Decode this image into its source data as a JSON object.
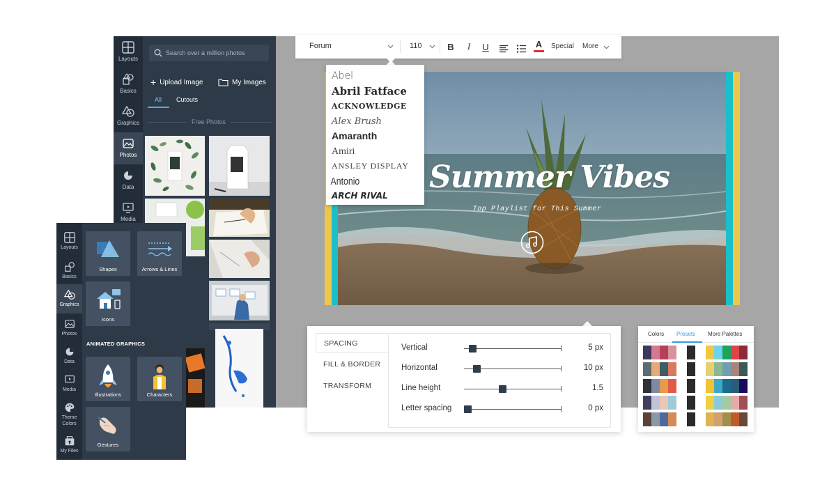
{
  "sidebar": {
    "items": [
      {
        "label": "Layouts"
      },
      {
        "label": "Basics"
      },
      {
        "label": "Graphics"
      },
      {
        "label": "Photos"
      },
      {
        "label": "Data"
      },
      {
        "label": "Media"
      }
    ],
    "active_index": 3
  },
  "photos_panel": {
    "search_placeholder": "Search over a million photos",
    "upload_label": "Upload Image",
    "my_images_label": "My Images",
    "tabs": [
      {
        "label": "All"
      },
      {
        "label": "Cutouts"
      }
    ],
    "section_label": "Free Photos"
  },
  "sidebar2": {
    "items": [
      {
        "label": "Layouts"
      },
      {
        "label": "Basics"
      },
      {
        "label": "Graphics"
      },
      {
        "label": "Photos"
      },
      {
        "label": "Data"
      },
      {
        "label": "Media"
      },
      {
        "label": "Theme Colors"
      },
      {
        "label": "My Files"
      }
    ],
    "active_index": 2
  },
  "graphics_panel": {
    "cards": [
      {
        "label": "Shapes"
      },
      {
        "label": "Arrows & Lines"
      },
      {
        "label": "Icons"
      }
    ],
    "animated_heading": "ANIMATED GRAPHICS",
    "animated_cards": [
      {
        "label": "Illustrations"
      },
      {
        "label": "Characters"
      },
      {
        "label": "Gestures"
      }
    ]
  },
  "toolbar": {
    "font": "Forum",
    "size": "110",
    "bold": "B",
    "italic": "I",
    "underline": "U",
    "color_letter": "A",
    "special_label": "Special",
    "more_label": "More",
    "text_color": "#e0332a"
  },
  "font_dropdown": {
    "fonts": [
      {
        "label": "Abel"
      },
      {
        "label": "Abril Fatface"
      },
      {
        "label": "ACKNOWLEDGE"
      },
      {
        "label": "Alex Brush"
      },
      {
        "label": "Amaranth"
      },
      {
        "label": "Amiri"
      },
      {
        "label": "ANSLEY DISPLAY"
      },
      {
        "label": "Antonio"
      },
      {
        "label": "ARCH RIVAL"
      }
    ]
  },
  "slide": {
    "title": "Summer Vibes",
    "subtitle": "Top Playlist for This Summer",
    "stripe_yellow": "#ecc74a",
    "stripe_teal": "#1bbfc9"
  },
  "spacing_panel": {
    "tabs": [
      {
        "label": "SPACING"
      },
      {
        "label": "FILL & BORDER"
      },
      {
        "label": "TRANSFORM"
      }
    ],
    "rows": [
      {
        "label": "Vertical",
        "value": "5 px",
        "level": 0.05
      },
      {
        "label": "Horizontal",
        "value": "10 px",
        "level": 0.1
      },
      {
        "label": "Line height",
        "value": "1.5",
        "level": 0.37
      },
      {
        "label": "Letter spacing",
        "value": "0 px",
        "level": 0.0
      }
    ]
  },
  "palette_panel": {
    "tabs": [
      {
        "label": "Colors"
      },
      {
        "label": "Presets"
      },
      {
        "label": "More Palettes"
      }
    ],
    "active_index": 1,
    "rows": [
      [
        "#3b3a5c",
        "#d4798f",
        "#b54156",
        "#d9919d",
        null,
        "#2b2b2e",
        null,
        "#f3c73d",
        "#6fd3ea",
        "#1ea35a",
        "#e0424a",
        "#8b2a3a"
      ],
      [
        "#5a6d74",
        "#e8a976",
        "#3d5d67",
        "#d77a62",
        null,
        "#2b2b2e",
        null,
        "#e8d070",
        "#8ab88f",
        "#6e9fb3",
        "#a88578",
        "#3b5a56"
      ],
      [
        "#2e3138",
        "#7d8aa3",
        "#e89a48",
        "#e05a4a",
        null,
        "#2b2b2e",
        null,
        "#f2c230",
        "#3ea9c7",
        "#1d6a8f",
        "#2b5c7a",
        "#1b0a5c"
      ],
      [
        "#40405e",
        "#c0c2d8",
        "#e8c7b7",
        "#9ecbd8",
        null,
        "#2b2b2e",
        null,
        "#f0cf40",
        "#89cbdb",
        "#a7c9a0",
        "#e8a9a9",
        "#9e4e56"
      ],
      [
        "#5b4238",
        "#8a99a8",
        "#4e6a9a",
        "#d68a58",
        null,
        "#2b2b2e",
        null,
        "#e0b252",
        "#d0a070",
        "#a09048",
        "#c25a28",
        "#6a4838"
      ]
    ]
  }
}
